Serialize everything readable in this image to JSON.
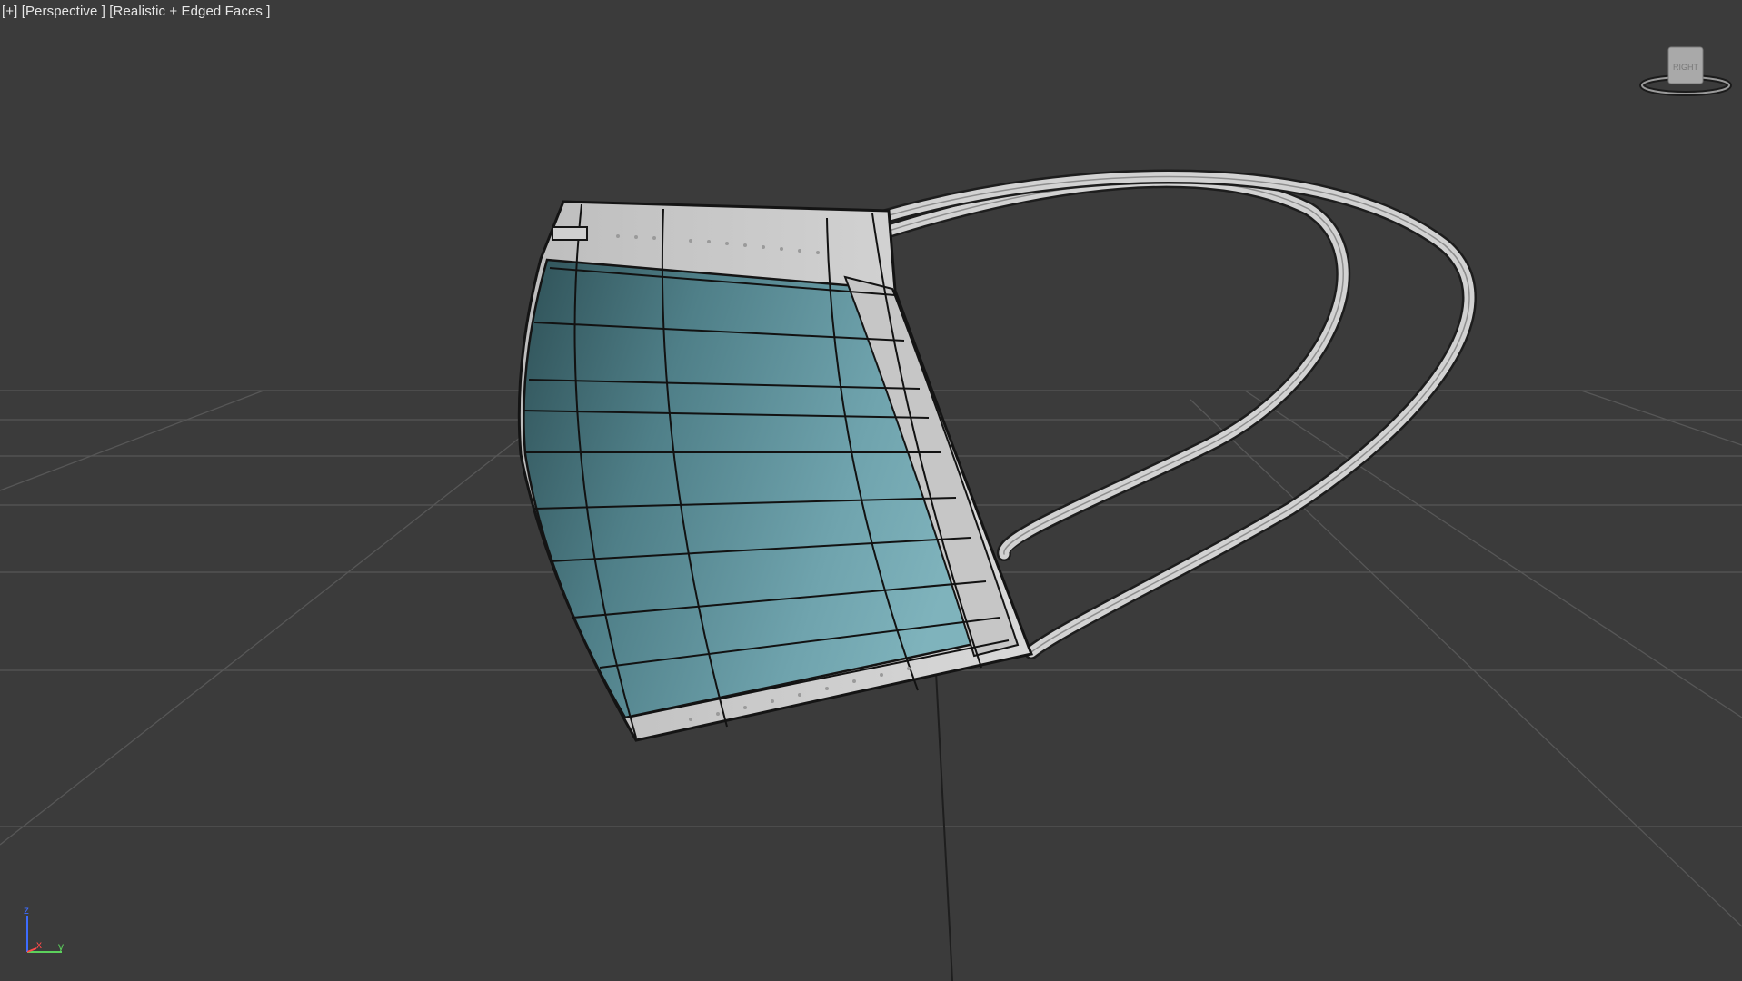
{
  "viewport": {
    "menu_label": "[+]",
    "view_label": "[Perspective ]",
    "shading_label": "[Realistic + Edged Faces ]"
  },
  "viewcube": {
    "face_label": "RIGHT"
  },
  "axis_tripod": {
    "z_label": "z",
    "x_label": "x",
    "y_label": "y"
  },
  "scene": {
    "object": "surgical-mask",
    "mask_color": "#5e8f98",
    "edge_color": "#1a1a1a",
    "ear_loop_color": "#cfcfcf",
    "grid_color": "#5a5a5a"
  }
}
